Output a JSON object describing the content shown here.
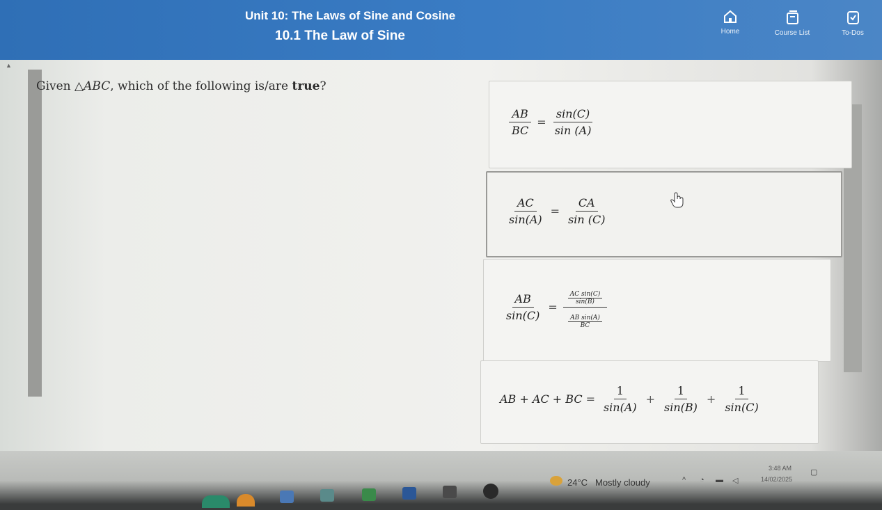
{
  "header": {
    "unit_title": "Unit 10: The Laws of Sine and Cosine",
    "lesson_title": "10.1 The Law of Sine",
    "nav": [
      {
        "label": "Home",
        "icon": "home-icon"
      },
      {
        "label": "Course List",
        "icon": "course-list-icon"
      },
      {
        "label": "To-Dos",
        "icon": "todos-icon"
      }
    ]
  },
  "question": {
    "prefix": "Given ",
    "triangle": "△ABC",
    "middle": ", which of the following is/are ",
    "emphasis": "true",
    "suffix": "?"
  },
  "options": [
    {
      "lhs_num": "AB",
      "lhs_den": "BC",
      "rhs_num": "sin(C)",
      "rhs_den": "sin (A)"
    },
    {
      "lhs_num": "AC",
      "lhs_den": "sin(A)",
      "rhs_num": "CA",
      "rhs_den": "sin (C)"
    },
    {
      "lhs_num": "AB",
      "lhs_den": "sin(C)",
      "rhs_top_num": "AC sin(C)",
      "rhs_top_den": "sin(B)",
      "rhs_bot_num": "AB sin(A)",
      "rhs_bot_den": "BC"
    },
    {
      "lhs": "AB + AC + BC",
      "t1_num": "1",
      "t1_den": "sin(A)",
      "t2_num": "1",
      "t2_den": "sin(B)",
      "t3_num": "1",
      "t3_den": "sin(C)"
    }
  ],
  "symbols": {
    "eq": "=",
    "plus": "+"
  },
  "taskbar": {
    "temperature": "24°C",
    "weather": "Mostly cloudy",
    "time": "3:48 AM",
    "date": "14/02/2025"
  },
  "colors": {
    "header": "#3a7cc4",
    "header_text": "#ffffff",
    "page_bg": "#f1f1ee"
  }
}
